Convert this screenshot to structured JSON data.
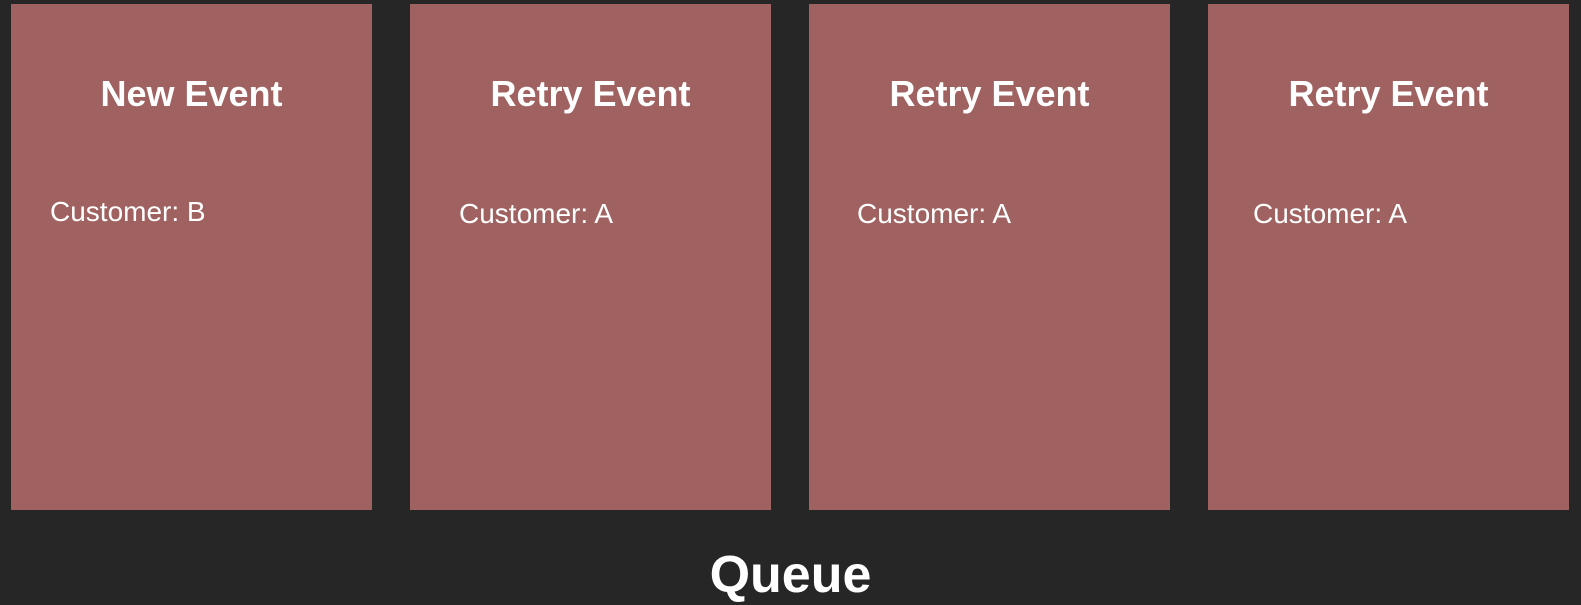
{
  "events": [
    {
      "title": "New Event",
      "customer": "Customer: B"
    },
    {
      "title": "Retry Event",
      "customer": "Customer: A"
    },
    {
      "title": "Retry Event",
      "customer": "Customer: A"
    },
    {
      "title": "Retry Event",
      "customer": "Customer: A"
    }
  ],
  "queue_label": "Queue",
  "colors": {
    "background": "#262626",
    "card": "#a06161",
    "text": "#ffffff"
  }
}
